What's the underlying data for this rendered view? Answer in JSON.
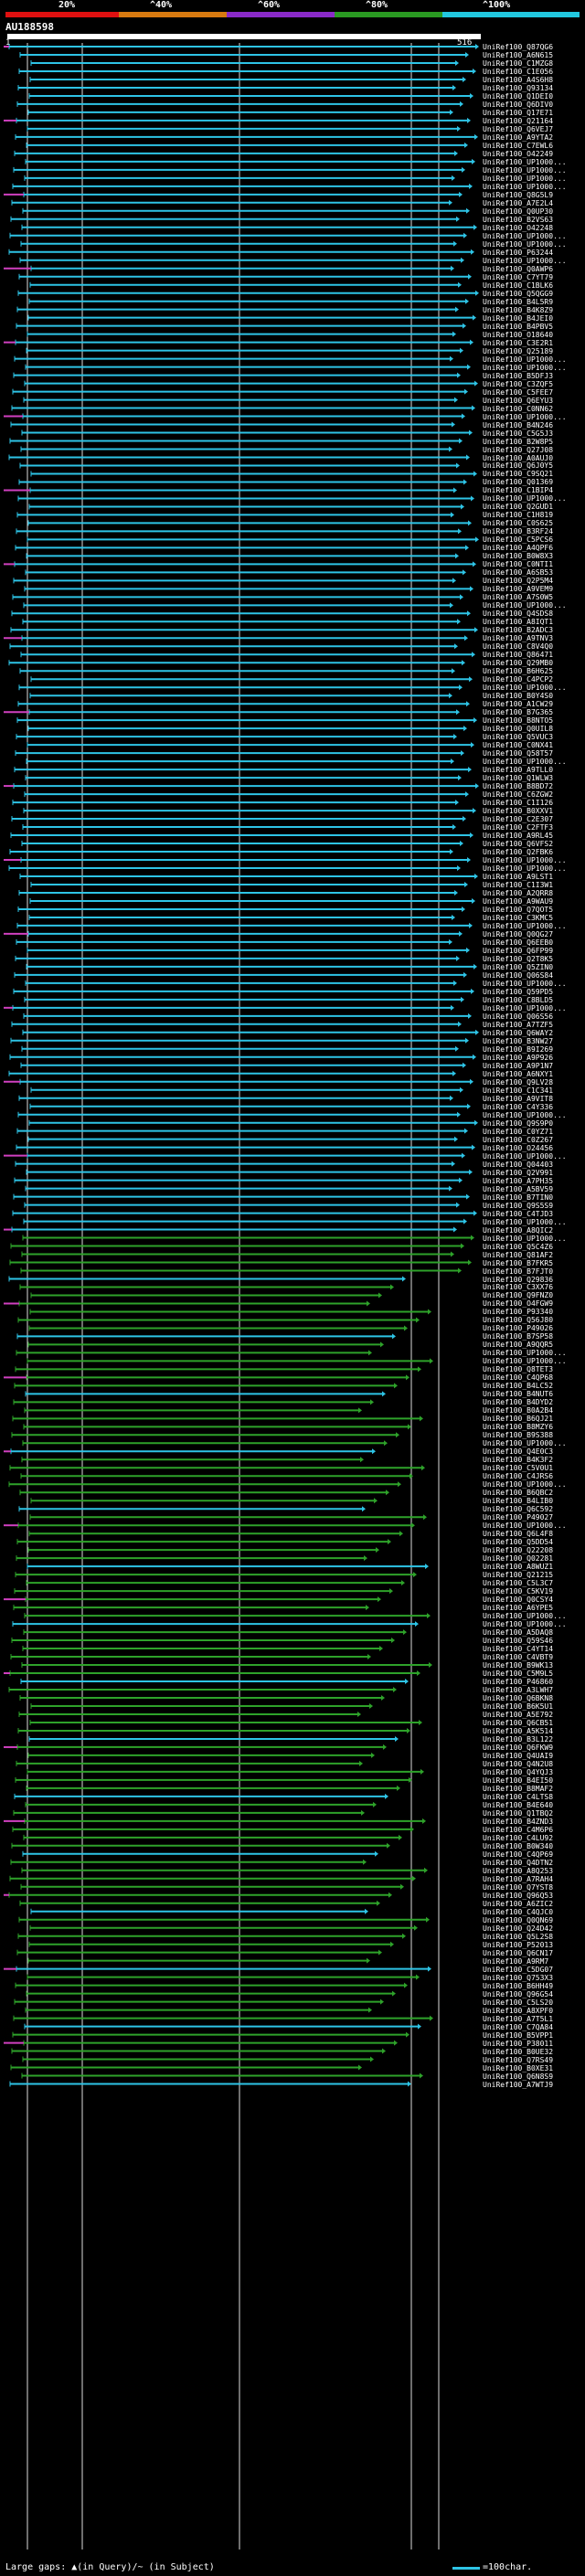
{
  "scale": {
    "ticks": [
      "20%",
      "^40%",
      "^60%",
      "^80%",
      "^100%"
    ],
    "band_colors": [
      "#e01010",
      "#d87a10",
      "#8a2ac8",
      "#2a9a22",
      "#22c8e0"
    ]
  },
  "query": {
    "name": "AU188598",
    "start": "1",
    "end": "516"
  },
  "colors": {
    "high": "#2ec4e6",
    "mid": "#2ea22a",
    "low": "#7a3ab8",
    "edge": "#d040c0"
  },
  "hit_labels": [
    "UniRef100_Q87QG6",
    "UniRef100_A6N615",
    "UniRef100_C1MZG8",
    "UniRef100_C1E056",
    "UniRef100_A4S6H8",
    "UniRef100_Q93134",
    "UniRef100_Q1DEI0",
    "UniRef100_Q6DIV0",
    "UniRef100_Q17E71",
    "UniRef100_Q21164",
    "UniRef100_Q6VEJ7",
    "UniRef100_A9YTA2",
    "UniRef100_C7EWL6",
    "UniRef100_O42249",
    "UniRef100_UP1000...",
    "UniRef100_UP1000...",
    "UniRef100_UP1000...",
    "UniRef100_UP1000...",
    "UniRef100_Q8G5L9",
    "UniRef100_A7E2L4",
    "UniRef100_Q0UP30",
    "UniRef100_B2VS63",
    "UniRef100_O42248",
    "UniRef100_UP1000...",
    "UniRef100_UP1000...",
    "UniRef100_P63244",
    "UniRef100_UP1000...",
    "UniRef100_Q0AWP6",
    "UniRef100_C7YT79",
    "UniRef100_C1BLK6",
    "UniRef100_Q5QGG9",
    "UniRef100_B4L5R9",
    "UniRef100_B4K8Z9",
    "UniRef100_B4JEI0",
    "UniRef100_B4PBV5",
    "UniRef100_O18640",
    "UniRef100_C3E2R1",
    "UniRef100_Q25189",
    "UniRef100_UP1000...",
    "UniRef100_UP1000...",
    "UniRef100_B5DFJ3",
    "UniRef100_C3ZQF5",
    "UniRef100_C5FEE7",
    "UniRef100_Q6EYU3",
    "UniRef100_C0NN62",
    "UniRef100_UP1000...",
    "UniRef100_B4N246",
    "UniRef100_C5G5J3",
    "UniRef100_B2W8P5",
    "UniRef100_Q27J08",
    "UniRef100_A0AUJ0",
    "UniRef100_Q6J0Y5",
    "UniRef100_C9SQ21",
    "UniRef100_Q01369",
    "UniRef100_C1BIP4",
    "UniRef100_UP1000...",
    "UniRef100_Q2GUD1",
    "UniRef100_C1H819",
    "UniRef100_C0S625",
    "UniRef100_B3RF24",
    "UniRef100_C5PCS6",
    "UniRef100_A4QPF6",
    "UniRef100_B0W8X3",
    "UniRef100_C0NTI1",
    "UniRef100_A6SB53",
    "UniRef100_Q2P5M4",
    "UniRef100_A9VEM9",
    "UniRef100_A7S0W5",
    "UniRef100_UP1000...",
    "UniRef100_Q4SDS8",
    "UniRef100_A8IQT1",
    "UniRef100_B2ADC3",
    "UniRef100_A9TNV3",
    "UniRef100_C8V4Q0",
    "UniRef100_Q86471",
    "UniRef100_Q29MB0",
    "UniRef100_B6H625",
    "UniRef100_C4PCP2",
    "UniRef100_UP1000...",
    "UniRef100_B0Y4S0",
    "UniRef100_A1CW29",
    "UniRef100_B7G365",
    "UniRef100_B8NTO5",
    "UniRef100_Q0UIL8",
    "UniRef100_Q5VUC3",
    "UniRef100_C0NX41",
    "UniRef100_Q58T57",
    "UniRef100_UP1000...",
    "UniRef100_A9TLL0",
    "UniRef100_Q1WLW3",
    "UniRef100_B8BD72",
    "UniRef100_C6ZGW2",
    "UniRef100_C1I126",
    "UniRef100_B0XXV1",
    "UniRef100_C2E307",
    "UniRef100_C2FTF3",
    "UniRef100_A9RL45",
    "UniRef100_Q6VFS2",
    "UniRef100_Q2FBK6",
    "UniRef100_UP1000...",
    "UniRef100_UP1000...",
    "UniRef100_A9LST1",
    "UniRef100_C1I3W1",
    "UniRef100_A2QRR8",
    "UniRef100_A9WAU9",
    "UniRef100_Q7QOT5",
    "UniRef100_C3KMC5",
    "UniRef100_UP1000...",
    "UniRef100_Q0QG27",
    "UniRef100_Q6EEB0",
    "UniRef100_Q6FP99",
    "UniRef100_Q2T8K5",
    "UniRef100_Q5ZIN0",
    "UniRef100_Q06S84",
    "UniRef100_UP1000...",
    "UniRef100_Q59PD5",
    "UniRef100_C8BLD5",
    "UniRef100_UP1000...",
    "UniRef100_Q06S56",
    "UniRef100_A7TZF5",
    "UniRef100_Q6WAY2",
    "UniRef100_B3NW27",
    "UniRef100_B9I269",
    "UniRef100_A9P926",
    "UniRef100_A9P1N7",
    "UniRef100_A6NXY1",
    "UniRef100_Q9LV28",
    "UniRef100_C1C341",
    "UniRef100_A9VIT8",
    "UniRef100_C4Y336",
    "UniRef100_UP1000...",
    "UniRef100_Q9S9P0",
    "UniRef100_C0YZ71",
    "UniRef100_C0Z267",
    "UniRef100_O24456",
    "UniRef100_UP1000...",
    "UniRef100_Q04403",
    "UniRef100_Q2V991",
    "UniRef100_A7PH35",
    "UniRef100_A5BV59",
    "UniRef100_B7TIN0",
    "UniRef100_Q9S5S9",
    "UniRef100_C4TJD3",
    "UniRef100_UP1000...",
    "UniRef100_A8QIC2",
    "UniRef100_UP1000...",
    "UniRef100_Q5C4Z6",
    "UniRef100_Q81AF2",
    "UniRef100_B7FKR5",
    "UniRef100_B7FJT0",
    "UniRef100_Q29836",
    "UniRef100_C3XX76",
    "UniRef100_Q9FNZ0",
    "UniRef100_O4FGW9",
    "UniRef100_P93340",
    "UniRef100_Q56J80",
    "UniRef100_P49026",
    "UniRef100_B7SP58",
    "UniRef100_A9QQR5",
    "UniRef100_UP1000...",
    "UniRef100_UP1000...",
    "UniRef100_Q8TET3",
    "UniRef100_C4QP68",
    "UniRef100_B4LC52",
    "UniRef100_B4NUT6",
    "UniRef100_B4DYD2",
    "UniRef100_B0A2B4",
    "UniRef100_B6QJ21",
    "UniRef100_B8MZY6",
    "UniRef100_B9S388",
    "UniRef100_UP1000...",
    "UniRef100_Q4E0C3",
    "UniRef100_B4K3F2",
    "UniRef100_C5V0U1",
    "UniRef100_C4JRS6",
    "UniRef100_UP1000...",
    "UniRef100_B6QBC2",
    "UniRef100_B4LIB0",
    "UniRef100_Q6C592",
    "UniRef100_P49027",
    "UniRef100_UP1000...",
    "UniRef100_Q6L4F8",
    "UniRef100_Q5DD54",
    "UniRef100_Q22208",
    "UniRef100_Q02281",
    "UniRef100_A8WUZ1",
    "UniRef100_Q21215",
    "UniRef100_C5L3C7",
    "UniRef100_C5KV19",
    "UniRef100_Q0CSY4",
    "UniRef100_A6YPE5",
    "UniRef100_UP1000...",
    "UniRef100_UP1000...",
    "UniRef100_A5DAQ8",
    "UniRef100_Q59S46",
    "UniRef100_C4YT14",
    "UniRef100_C4VBT9",
    "UniRef100_B9WK13",
    "UniRef100_C5M9L5",
    "UniRef100_P46860",
    "UniRef100_A3LWH7",
    "UniRef100_Q6BKN8",
    "UniRef100_B6K5U1",
    "UniRef100_A5E792",
    "UniRef100_Q6CB51",
    "UniRef100_A5K514",
    "UniRef100_B3L122",
    "UniRef100_Q6FKW9",
    "UniRef100_Q4UAI9",
    "UniRef100_Q4N2U8",
    "UniRef100_Q4YQJ3",
    "UniRef100_B4EI50",
    "UniRef100_B8MAF2",
    "UniRef100_C4LTS8",
    "UniRef100_B4E640",
    "UniRef100_Q1TBQ2",
    "UniRef100_B4ZND3",
    "UniRef100_C4M6P6",
    "UniRef100_C4LU92",
    "UniRef100_B0W340",
    "UniRef100_C4QP69",
    "UniRef100_Q4DTN2",
    "UniRef100_A8Q253",
    "UniRef100_A7RAH4",
    "UniRef100_Q7YST8",
    "UniRef100_Q96Q53",
    "UniRef100_A6ZIC2",
    "UniRef100_C4QJC0",
    "UniRef100_Q0QN69",
    "UniRef100_Q24D42",
    "UniRef100_Q5L2S8",
    "UniRef100_P52013",
    "UniRef100_Q6CN17",
    "UniRef100_A9RM7",
    "UniRef100_C5DG07",
    "UniRef100_Q753X3",
    "UniRef100_B6HH49",
    "UniRef100_Q96G54",
    "UniRef100_C5LS20",
    "UniRef100_A8XPF0",
    "UniRef100_A7T5L1",
    "UniRef100_C7QA84",
    "UniRef100_B5VPP1",
    "UniRef100_P38011",
    "UniRef100_B0UE32",
    "UniRef100_Q7RS49",
    "UniRef100_B0XE31",
    "UniRef100_Q6N8S9",
    "UniRef100_A7WTJ9"
  ],
  "footer": {
    "gaps_text": "Large gaps: ▲(in Query)/~ (in Subject)",
    "legend_text": "=100char."
  }
}
